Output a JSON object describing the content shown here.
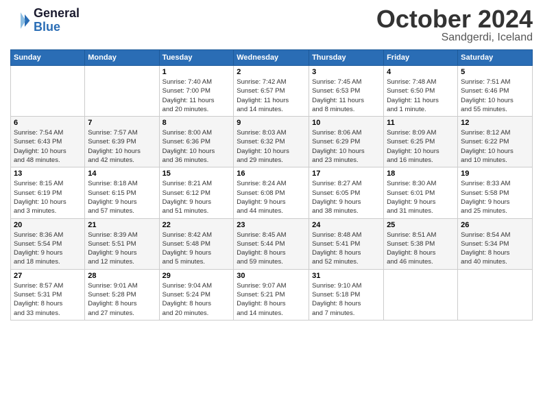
{
  "header": {
    "logo_line1": "General",
    "logo_line2": "Blue",
    "month": "October 2024",
    "location": "Sandgerdi, Iceland"
  },
  "weekdays": [
    "Sunday",
    "Monday",
    "Tuesday",
    "Wednesday",
    "Thursday",
    "Friday",
    "Saturday"
  ],
  "weeks": [
    [
      {
        "day": "",
        "info": ""
      },
      {
        "day": "",
        "info": ""
      },
      {
        "day": "1",
        "info": "Sunrise: 7:40 AM\nSunset: 7:00 PM\nDaylight: 11 hours\nand 20 minutes."
      },
      {
        "day": "2",
        "info": "Sunrise: 7:42 AM\nSunset: 6:57 PM\nDaylight: 11 hours\nand 14 minutes."
      },
      {
        "day": "3",
        "info": "Sunrise: 7:45 AM\nSunset: 6:53 PM\nDaylight: 11 hours\nand 8 minutes."
      },
      {
        "day": "4",
        "info": "Sunrise: 7:48 AM\nSunset: 6:50 PM\nDaylight: 11 hours\nand 1 minute."
      },
      {
        "day": "5",
        "info": "Sunrise: 7:51 AM\nSunset: 6:46 PM\nDaylight: 10 hours\nand 55 minutes."
      }
    ],
    [
      {
        "day": "6",
        "info": "Sunrise: 7:54 AM\nSunset: 6:43 PM\nDaylight: 10 hours\nand 48 minutes."
      },
      {
        "day": "7",
        "info": "Sunrise: 7:57 AM\nSunset: 6:39 PM\nDaylight: 10 hours\nand 42 minutes."
      },
      {
        "day": "8",
        "info": "Sunrise: 8:00 AM\nSunset: 6:36 PM\nDaylight: 10 hours\nand 36 minutes."
      },
      {
        "day": "9",
        "info": "Sunrise: 8:03 AM\nSunset: 6:32 PM\nDaylight: 10 hours\nand 29 minutes."
      },
      {
        "day": "10",
        "info": "Sunrise: 8:06 AM\nSunset: 6:29 PM\nDaylight: 10 hours\nand 23 minutes."
      },
      {
        "day": "11",
        "info": "Sunrise: 8:09 AM\nSunset: 6:25 PM\nDaylight: 10 hours\nand 16 minutes."
      },
      {
        "day": "12",
        "info": "Sunrise: 8:12 AM\nSunset: 6:22 PM\nDaylight: 10 hours\nand 10 minutes."
      }
    ],
    [
      {
        "day": "13",
        "info": "Sunrise: 8:15 AM\nSunset: 6:19 PM\nDaylight: 10 hours\nand 3 minutes."
      },
      {
        "day": "14",
        "info": "Sunrise: 8:18 AM\nSunset: 6:15 PM\nDaylight: 9 hours\nand 57 minutes."
      },
      {
        "day": "15",
        "info": "Sunrise: 8:21 AM\nSunset: 6:12 PM\nDaylight: 9 hours\nand 51 minutes."
      },
      {
        "day": "16",
        "info": "Sunrise: 8:24 AM\nSunset: 6:08 PM\nDaylight: 9 hours\nand 44 minutes."
      },
      {
        "day": "17",
        "info": "Sunrise: 8:27 AM\nSunset: 6:05 PM\nDaylight: 9 hours\nand 38 minutes."
      },
      {
        "day": "18",
        "info": "Sunrise: 8:30 AM\nSunset: 6:01 PM\nDaylight: 9 hours\nand 31 minutes."
      },
      {
        "day": "19",
        "info": "Sunrise: 8:33 AM\nSunset: 5:58 PM\nDaylight: 9 hours\nand 25 minutes."
      }
    ],
    [
      {
        "day": "20",
        "info": "Sunrise: 8:36 AM\nSunset: 5:54 PM\nDaylight: 9 hours\nand 18 minutes."
      },
      {
        "day": "21",
        "info": "Sunrise: 8:39 AM\nSunset: 5:51 PM\nDaylight: 9 hours\nand 12 minutes."
      },
      {
        "day": "22",
        "info": "Sunrise: 8:42 AM\nSunset: 5:48 PM\nDaylight: 9 hours\nand 5 minutes."
      },
      {
        "day": "23",
        "info": "Sunrise: 8:45 AM\nSunset: 5:44 PM\nDaylight: 8 hours\nand 59 minutes."
      },
      {
        "day": "24",
        "info": "Sunrise: 8:48 AM\nSunset: 5:41 PM\nDaylight: 8 hours\nand 52 minutes."
      },
      {
        "day": "25",
        "info": "Sunrise: 8:51 AM\nSunset: 5:38 PM\nDaylight: 8 hours\nand 46 minutes."
      },
      {
        "day": "26",
        "info": "Sunrise: 8:54 AM\nSunset: 5:34 PM\nDaylight: 8 hours\nand 40 minutes."
      }
    ],
    [
      {
        "day": "27",
        "info": "Sunrise: 8:57 AM\nSunset: 5:31 PM\nDaylight: 8 hours\nand 33 minutes."
      },
      {
        "day": "28",
        "info": "Sunrise: 9:01 AM\nSunset: 5:28 PM\nDaylight: 8 hours\nand 27 minutes."
      },
      {
        "day": "29",
        "info": "Sunrise: 9:04 AM\nSunset: 5:24 PM\nDaylight: 8 hours\nand 20 minutes."
      },
      {
        "day": "30",
        "info": "Sunrise: 9:07 AM\nSunset: 5:21 PM\nDaylight: 8 hours\nand 14 minutes."
      },
      {
        "day": "31",
        "info": "Sunrise: 9:10 AM\nSunset: 5:18 PM\nDaylight: 8 hours\nand 7 minutes."
      },
      {
        "day": "",
        "info": ""
      },
      {
        "day": "",
        "info": ""
      }
    ]
  ]
}
